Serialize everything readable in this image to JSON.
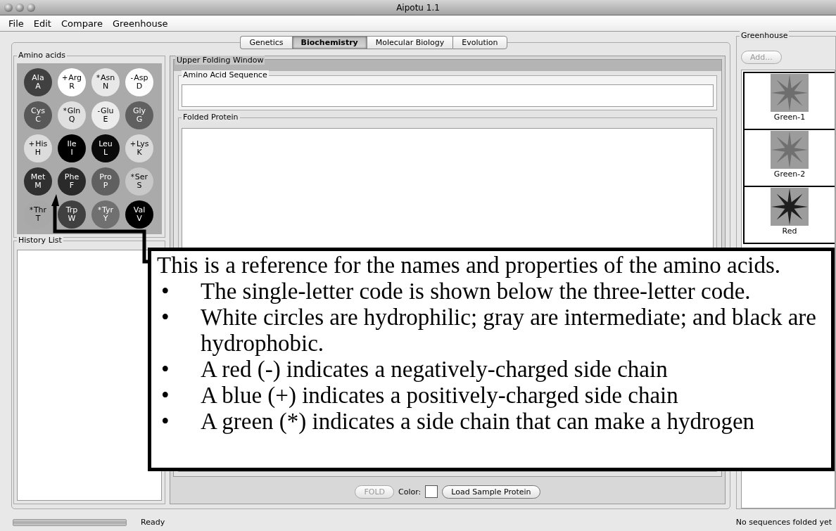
{
  "window": {
    "title": "Aipotu 1.1"
  },
  "menu": [
    "File",
    "Edit",
    "Compare",
    "Greenhouse"
  ],
  "tabs": [
    {
      "label": "Genetics",
      "selected": false
    },
    {
      "label": "Biochemistry",
      "selected": true
    },
    {
      "label": "Molecular Biology",
      "selected": false
    },
    {
      "label": "Evolution",
      "selected": false
    }
  ],
  "amino_acids": {
    "title": "Amino acids",
    "items": [
      {
        "code3": "Ala",
        "code1": "A",
        "color": "#404040"
      },
      {
        "code3": "Arg",
        "code1": "R",
        "mark": "+",
        "color": "#ffffff"
      },
      {
        "code3": "Asn",
        "code1": "N",
        "mark": "*",
        "color": "#e8e8e8"
      },
      {
        "code3": "Asp",
        "code1": "D",
        "mark": "-",
        "color": "#fcfcfc"
      },
      {
        "code3": "Cys",
        "code1": "C",
        "color": "#585858"
      },
      {
        "code3": "Gln",
        "code1": "Q",
        "mark": "*",
        "color": "#e0e0e0"
      },
      {
        "code3": "Glu",
        "code1": "E",
        "mark": "-",
        "color": "#ececec"
      },
      {
        "code3": "Gly",
        "code1": "G",
        "color": "#606060"
      },
      {
        "code3": "His",
        "code1": "H",
        "mark": "+",
        "color": "#dcdcdc"
      },
      {
        "code3": "Ile",
        "code1": "I",
        "color": "#000000"
      },
      {
        "code3": "Leu",
        "code1": "L",
        "color": "#0a0a0a"
      },
      {
        "code3": "Lys",
        "code1": "K",
        "mark": "+",
        "color": "#dadada"
      },
      {
        "code3": "Met",
        "code1": "M",
        "color": "#303030"
      },
      {
        "code3": "Phe",
        "code1": "F",
        "color": "#2a2a2a"
      },
      {
        "code3": "Pro",
        "code1": "P",
        "color": "#606061"
      },
      {
        "code3": "Ser",
        "code1": "S",
        "mark": "*",
        "color": "#c8c8c8"
      },
      {
        "code3": "Thr",
        "code1": "T",
        "mark": "*",
        "color": "#a8a8a8"
      },
      {
        "code3": "Trp",
        "code1": "W",
        "color": "#404041"
      },
      {
        "code3": "Tyr",
        "code1": "Y",
        "mark": "*",
        "color": "#707070"
      },
      {
        "code3": "Val",
        "code1": "V",
        "color": "#000001"
      }
    ]
  },
  "history_list": {
    "title": "History List"
  },
  "upper_folding_window": {
    "title": "Upper Folding Window",
    "sequence_label": "Amino Acid Sequence",
    "folded_label": "Folded Protein"
  },
  "fold_button": {
    "label": "FOLD",
    "disabled": true
  },
  "color_label": "Color:",
  "load_button": {
    "label": "Load Sample Protein",
    "disabled": false
  },
  "greenhouse": {
    "title": "Greenhouse",
    "add_button": {
      "label": "Add...",
      "disabled": true
    },
    "organisms": [
      {
        "name": "Green-1",
        "color": "#6e6e6e"
      },
      {
        "name": "Green-2",
        "color": "#707071"
      },
      {
        "name": "Red",
        "color": "#1e1e1e"
      }
    ]
  },
  "status_bar": {
    "level": 0,
    "left": "Ready",
    "right": "No sequences folded yet"
  },
  "callout": {
    "intro": "This is a reference for the names and properties of the amino acids.",
    "bullets": [
      {
        "bullet": "•",
        "text": "The single-letter code is shown below the three-letter code."
      },
      {
        "bullet": "•",
        "text": "White circles are hydrophilic; gray are intermediate; and black are hydrophobic."
      },
      {
        "bullet": "•",
        "text": "A red (-) indicates a negatively-charged side chain"
      },
      {
        "bullet": "•",
        "text": "A blue (+) indicates a positively-charged side chain"
      },
      {
        "bullet": "•",
        "text": "A green (*) indicates a side chain that can make a hydrogen"
      }
    ]
  }
}
